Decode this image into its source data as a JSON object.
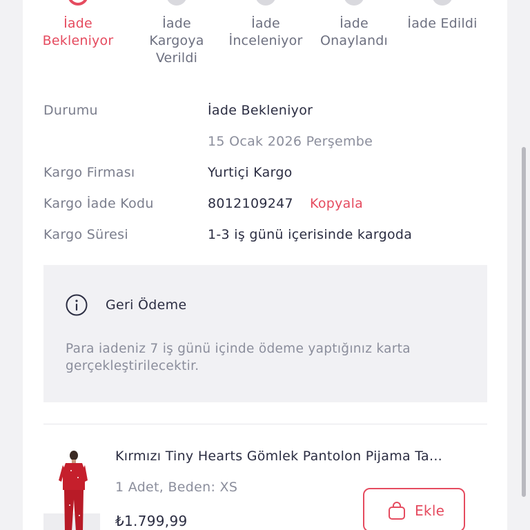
{
  "steps": [
    {
      "label": "İade Bekleniyor",
      "active": true
    },
    {
      "label": "İade Kargoya Verildi",
      "active": false
    },
    {
      "label": "İade İnceleniyor",
      "active": false
    },
    {
      "label": "İade Onaylandı",
      "active": false
    },
    {
      "label": "İade Edildi",
      "active": false
    }
  ],
  "details": {
    "status_label": "Durumu",
    "status_value": "İade Bekleniyor",
    "status_date": "15 Ocak 2026 Perşembe",
    "carrier_label": "Kargo Firması",
    "carrier_value": "Yurtiçi Kargo",
    "return_code_label": "Kargo İade Kodu",
    "return_code_value": "8012109247",
    "copy_label": "Kopyala",
    "duration_label": "Kargo Süresi",
    "duration_value": "1-3 iş günü içerisinde kargoda"
  },
  "refund": {
    "icon": "info-icon",
    "title": "Geri Ödeme",
    "description": "Para iadeniz 7 iş günü içinde ödeme yaptığınız karta gerçekleştirilecektir."
  },
  "product": {
    "name": "Kırmızı Tiny Hearts Gömlek Pantolon Pijama Ta...",
    "meta": "1 Adet, Beden: XS",
    "price": "₺1.799,99",
    "add_label": "Ekle",
    "add_icon": "shopping-bag-icon"
  },
  "colors": {
    "accent": "#e54b5f",
    "text_primary": "#2b2d42",
    "text_secondary": "#7a7d8c",
    "info_box_bg": "#f1f1f4",
    "page_bg": "#f2f2f4"
  }
}
